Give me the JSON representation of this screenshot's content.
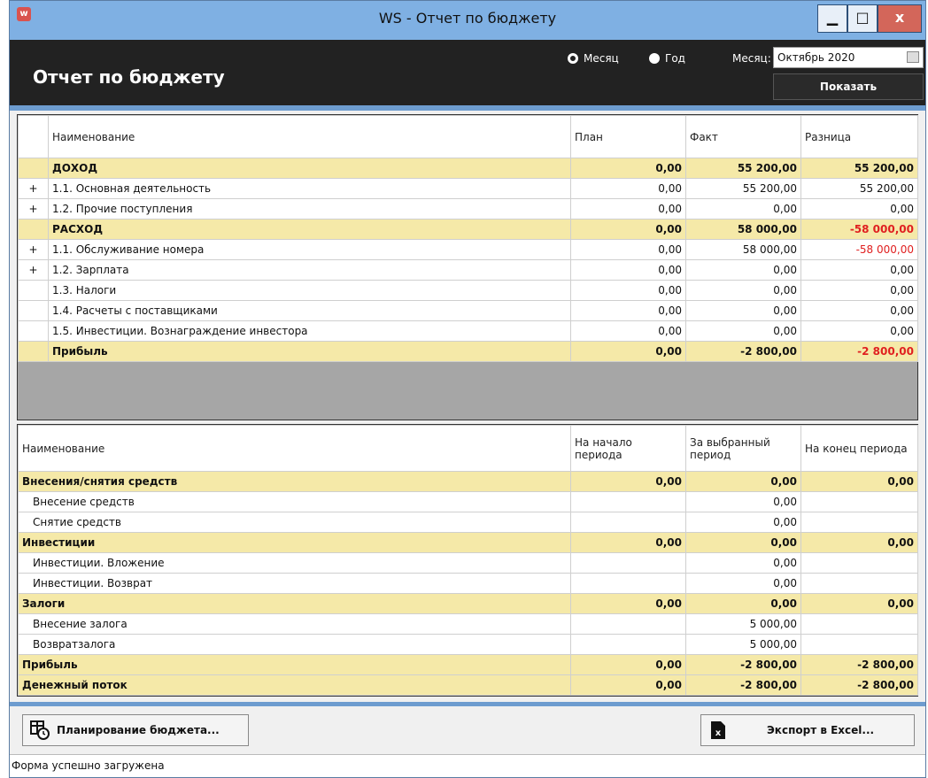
{
  "window": {
    "title": "WS - Отчет по бюджету",
    "min_glyph": "▁",
    "max_glyph": "□",
    "close_glyph": "x"
  },
  "header": {
    "title": "Отчет по бюджету",
    "radio_month": "Месяц",
    "radio_year": "Год",
    "month_label": "Месяц:",
    "month_value": "Октябрь 2020",
    "show_button": "Показать"
  },
  "budget_table": {
    "headers": [
      "Наименование",
      "План",
      "Факт",
      "Разница"
    ],
    "rows": [
      {
        "exp": "",
        "name": "ДОХОД",
        "plan": "0,00",
        "fact": "55 200,00",
        "diff": "55 200,00",
        "group": true,
        "neg": false
      },
      {
        "exp": "+",
        "name": "1.1. Основная деятельность",
        "plan": "0,00",
        "fact": "55 200,00",
        "diff": "55 200,00",
        "group": false,
        "neg": false
      },
      {
        "exp": "+",
        "name": "1.2. Прочие поступления",
        "plan": "0,00",
        "fact": "0,00",
        "diff": "0,00",
        "group": false,
        "neg": false
      },
      {
        "exp": "",
        "name": "РАСХОД",
        "plan": "0,00",
        "fact": "58 000,00",
        "diff": "-58 000,00",
        "group": true,
        "neg": true
      },
      {
        "exp": "+",
        "name": "1.1. Обслуживание номера",
        "plan": "0,00",
        "fact": "58 000,00",
        "diff": "-58 000,00",
        "group": false,
        "neg": true
      },
      {
        "exp": "+",
        "name": "1.2. Зарплата",
        "plan": "0,00",
        "fact": "0,00",
        "diff": "0,00",
        "group": false,
        "neg": false
      },
      {
        "exp": "",
        "name": "1.3. Налоги",
        "plan": "0,00",
        "fact": "0,00",
        "diff": "0,00",
        "group": false,
        "neg": false
      },
      {
        "exp": "",
        "name": "1.4. Расчеты с поставщиками",
        "plan": "0,00",
        "fact": "0,00",
        "diff": "0,00",
        "group": false,
        "neg": false
      },
      {
        "exp": "",
        "name": "1.5. Инвестиции. Вознаграждение инвестора",
        "plan": "0,00",
        "fact": "0,00",
        "diff": "0,00",
        "group": false,
        "neg": false
      },
      {
        "exp": "",
        "name": "Прибыль",
        "plan": "0,00",
        "fact": "-2 800,00",
        "diff": "-2 800,00",
        "group": true,
        "neg": true
      }
    ]
  },
  "cash_table": {
    "headers": [
      "Наименование",
      "На начало периода",
      "За выбранный период",
      "На конец периода"
    ],
    "rows": [
      {
        "name": "Внесения/снятия средств",
        "start": "0,00",
        "period": "0,00",
        "end": "0,00",
        "group": true
      },
      {
        "name": "Внесение средств",
        "start": "",
        "period": "0,00",
        "end": "",
        "group": false
      },
      {
        "name": "Снятие средств",
        "start": "",
        "period": "0,00",
        "end": "",
        "group": false
      },
      {
        "name": "Инвестиции",
        "start": "0,00",
        "period": "0,00",
        "end": "0,00",
        "group": true
      },
      {
        "name": "Инвестиции. Вложение",
        "start": "",
        "period": "0,00",
        "end": "",
        "group": false
      },
      {
        "name": "Инвестиции. Возврат",
        "start": "",
        "period": "0,00",
        "end": "",
        "group": false
      },
      {
        "name": "Залоги",
        "start": "0,00",
        "period": "0,00",
        "end": "0,00",
        "group": true
      },
      {
        "name": "Внесение залога",
        "start": "",
        "period": "5 000,00",
        "end": "",
        "group": false
      },
      {
        "name": "Возвратзалога",
        "start": "",
        "period": "5 000,00",
        "end": "",
        "group": false
      },
      {
        "name": "Прибыль",
        "start": "0,00",
        "period": "-2 800,00",
        "end": "-2 800,00",
        "group": true
      },
      {
        "name": "Денежный поток",
        "start": "0,00",
        "period": "-2 800,00",
        "end": "-2 800,00",
        "group": true
      }
    ]
  },
  "footer": {
    "plan_button": "Планирование бюджета...",
    "excel_button": "Экспорт в Excel...",
    "status": "Форма успешно загружена"
  },
  "colors": {
    "group_row": "#f5e9a8",
    "negative": "#e02020",
    "accent": "#6d9ccf"
  }
}
